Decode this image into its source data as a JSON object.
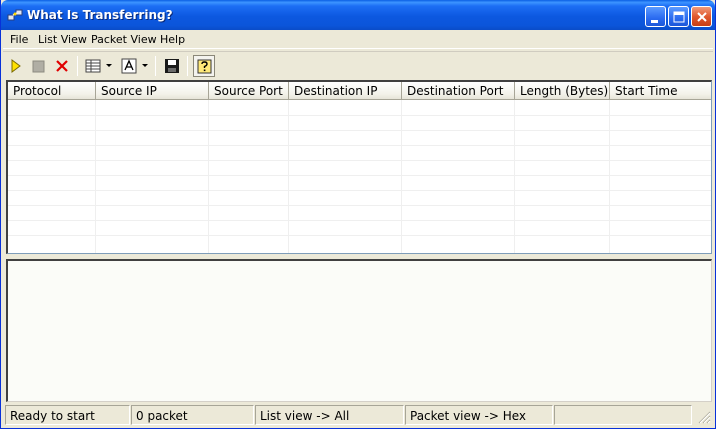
{
  "window": {
    "title": "What Is Transferring?",
    "accent": "#0b55da"
  },
  "menu": {
    "items": [
      {
        "label": "File"
      },
      {
        "label": "List View"
      },
      {
        "label": "Packet View"
      },
      {
        "label": "Help"
      }
    ]
  },
  "toolbar": {
    "icons": [
      "play-icon",
      "stop-icon",
      "delete-icon",
      "list-columns-icon",
      "font-icon",
      "save-icon",
      "help-icon"
    ]
  },
  "listview": {
    "columns": [
      {
        "label": "Protocol"
      },
      {
        "label": "Source IP"
      },
      {
        "label": "Source Port"
      },
      {
        "label": "Destination IP"
      },
      {
        "label": "Destination Port"
      },
      {
        "label": "Length (Bytes)"
      },
      {
        "label": "Start Time"
      }
    ]
  },
  "status": {
    "state": "Ready to start",
    "packets": "0 packet",
    "list_view": "List view -> All",
    "packet_view": "Packet view -> Hex",
    "extra": ""
  }
}
